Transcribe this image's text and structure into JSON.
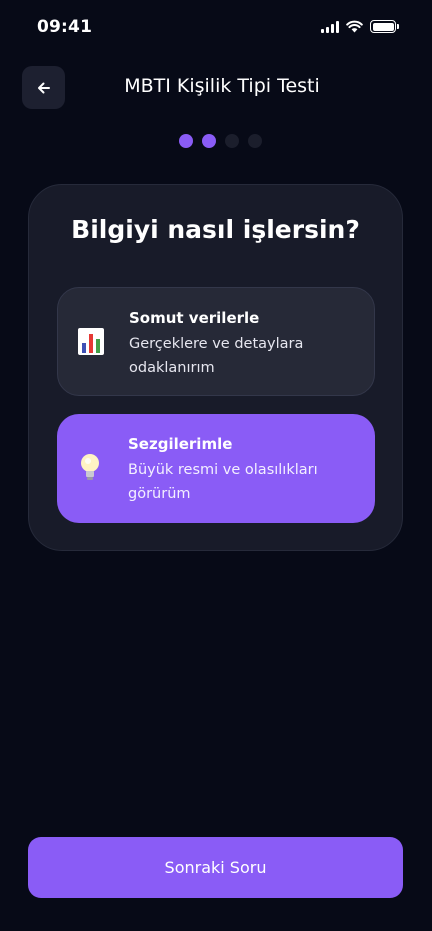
{
  "status_bar": {
    "time": "09:41"
  },
  "header": {
    "title": "MBTI Kişilik Tipi Testi"
  },
  "progress": {
    "total_steps": 4,
    "current_step": 2
  },
  "question": {
    "text": "Bilgiyi nasıl işlersin?",
    "options": [
      {
        "icon": "bar-chart-icon",
        "title": "Somut verilerle",
        "description": "Gerçeklere ve detaylara odaklanırım",
        "selected": false
      },
      {
        "icon": "lightbulb-icon",
        "title": "Sezgilerimle",
        "description": "Büyük resmi ve olasılıkları görürüm",
        "selected": true
      }
    ]
  },
  "footer": {
    "next_label": "Sonraki Soru"
  },
  "colors": {
    "background": "#070a17",
    "card": "#181b29",
    "option": "#262937",
    "accent": "#8a5cf6",
    "inactive_dot": "#1b1e2c"
  }
}
